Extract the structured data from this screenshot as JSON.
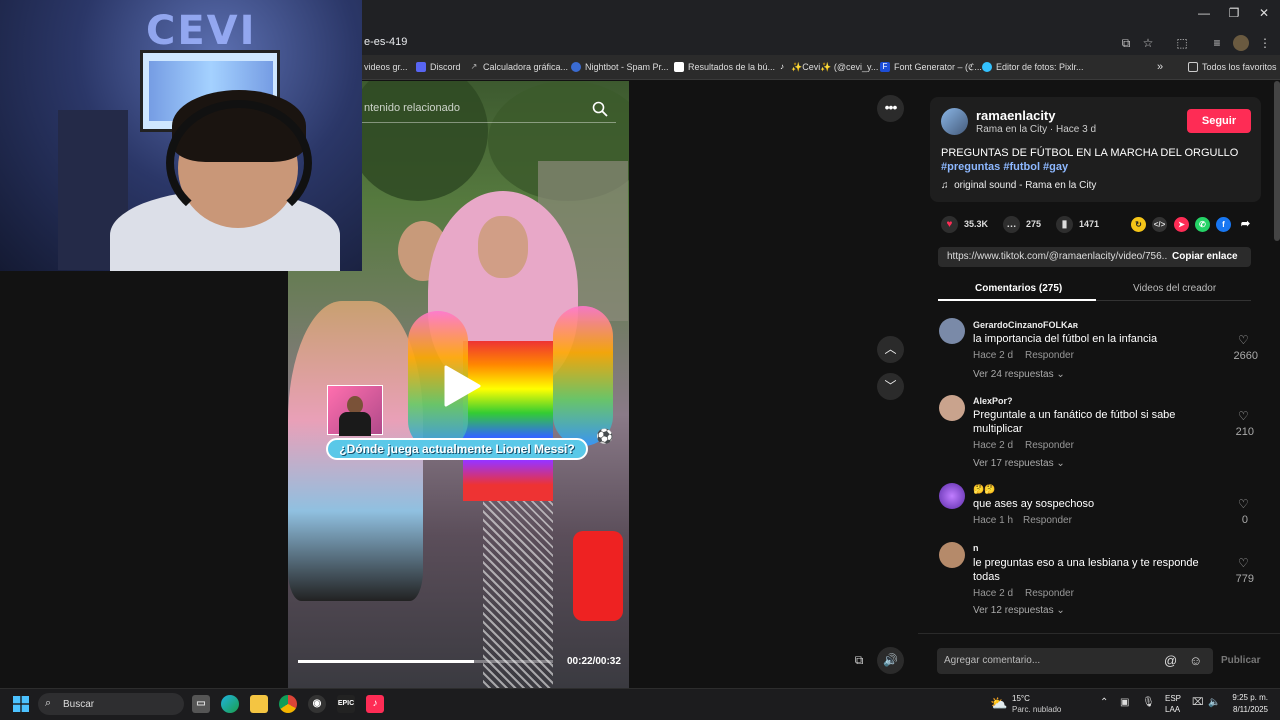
{
  "browser": {
    "url_fragment": "e-es-419",
    "bookmarks": [
      {
        "label": "videos gr...",
        "icon": "folder-icon"
      },
      {
        "label": "Discord",
        "icon": "discord-icon"
      },
      {
        "label": "Calculadora gráfica...",
        "icon": "calculator-icon"
      },
      {
        "label": "Nightbot - Spam Pr...",
        "icon": "nightbot-icon"
      },
      {
        "label": "Resultados de la bú...",
        "icon": "search-result-icon"
      },
      {
        "label": "✨Cevi✨ (@cevi_y...",
        "icon": "tiktok-icon"
      },
      {
        "label": "Font Generator – (ℭ...",
        "icon": "font-icon"
      },
      {
        "label": "Editor de fotos: Pixlr...",
        "icon": "pixlr-icon"
      }
    ],
    "all_favorites": "Todos los favoritos"
  },
  "video": {
    "search_placeholder": "ntenido relacionado",
    "question": "¿Dónde juega actualmente Lionel Messi?",
    "time": "00:22/00:32",
    "progress": 0.69
  },
  "post": {
    "username": "ramaenlacity",
    "subline": "Rama en la City · Hace 3 d",
    "follow": "Seguir",
    "title": "PREGUNTAS DE FÚTBOL EN LA MARCHA DEL ORGULLO",
    "tags": "#preguntas #futbol #gay",
    "sound": "original sound - Rama en la City",
    "likes": "35.3K",
    "comments": "275",
    "saves": "1471",
    "link": "https://www.tiktok.com/@ramaenlacity/video/756...",
    "copy_link": "Copiar enlace",
    "tab_comments": "Comentarios (275)",
    "tab_videos": "Videos del creador"
  },
  "comments": [
    {
      "user": "GerardoCinzanoFOLKᴀʀ",
      "text": "la importancia del fútbol en la infancia",
      "time": "Hace 2 d",
      "reply": "Responder",
      "more": "Ver 24 respuestas",
      "likes": "2660",
      "color": "#7a8aa8"
    },
    {
      "user": "AlexPor?",
      "text": "Preguntale a un fanático de fútbol si sabe multiplicar",
      "time": "Hace 2 d",
      "reply": "Responder",
      "more": "Ver 17 respuestas",
      "likes": "210",
      "color": "#c9a38d"
    },
    {
      "user": "🤔🤔",
      "text": "que ases ay sospechoso",
      "time": "Hace 1 h",
      "reply": "Responder",
      "more": "",
      "likes": "0",
      "color": "#8a4fd1"
    },
    {
      "user": "n",
      "text": "le preguntas eso a una lesbiana y te responde todas",
      "time": "Hace 2 d",
      "reply": "Responder",
      "more": "Ver 12 respuestas",
      "likes": "779",
      "color": "#b58a6a"
    }
  ],
  "composer": {
    "placeholder": "Agregar comentario...",
    "publish": "Publicar"
  },
  "taskbar": {
    "search": "Buscar",
    "temp": "15°C",
    "weather": "Parc. nublado",
    "lang1": "ESP",
    "lang2": "LAA",
    "time": "9:25 p. m.",
    "date": "8/11/2025"
  },
  "webcam": {
    "logo": "CEVI"
  },
  "colors": {
    "accent": "#fe2c55",
    "tag": "#8db8ff",
    "background": "#121212"
  }
}
